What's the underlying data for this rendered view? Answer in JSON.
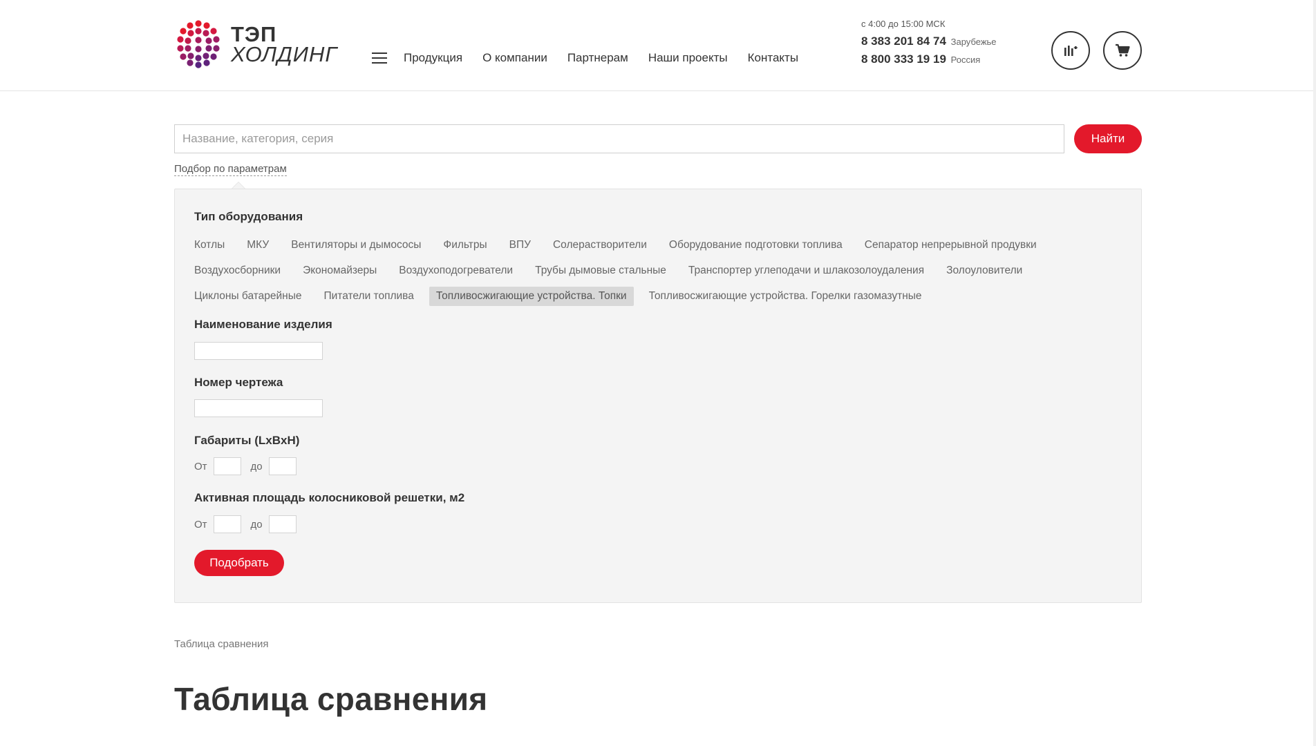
{
  "logo": {
    "line1": "ТЭП",
    "line2": "ХОЛДИНГ"
  },
  "nav": {
    "items": [
      "Продукция",
      "О компании",
      "Партнерам",
      "Наши проекты",
      "Контакты"
    ]
  },
  "contacts": {
    "hours": "с 4:00 до 15:00 МСК",
    "phone1": "8 383 201 84 74",
    "phone1_note": "Зарубежье",
    "phone2": "8 800 333 19 19",
    "phone2_note": "Россия"
  },
  "icons": {
    "menu": "hamburger-icon",
    "compare": "compare-icon",
    "cart": "cart-icon"
  },
  "search": {
    "placeholder": "Название, категория, серия",
    "value": "",
    "button": "Найти",
    "params_link": "Подбор по параметрам"
  },
  "filter": {
    "equipment_title": "Тип оборудования",
    "tag_rows": [
      [
        "Котлы",
        "МКУ",
        "Вентиляторы и дымососы",
        "Фильтры",
        "ВПУ",
        "Солерастворители",
        "Оборудование подготовки топлива",
        "Сепаратор непрерывной продувки"
      ],
      [
        "Воздухосборники",
        "Экономайзеры",
        "Воздухоподогреватели",
        "Трубы дымовые стальные",
        "Транспортер углеподачи и шлакозолоудаления",
        "Золоуловители"
      ],
      [
        "Циклоны батарейные",
        "Питатели топлива",
        "Топливосжигающие устройства. Топки",
        "Топливосжигающие устройства. Горелки газомазутные"
      ]
    ],
    "active_tag": "Топливосжигающие устройства. Топки",
    "name_title": "Наименование изделия",
    "drawing_title": "Номер чертежа",
    "size_title": "Габариты (LxBxH)",
    "area_title": "Активная площадь колосниковой решетки, м2",
    "from_label": "От",
    "to_label": "до",
    "apply_button": "Подобрать"
  },
  "breadcrumb": "Таблица сравнения",
  "page_title": "Таблица сравнения",
  "colors": {
    "accent": "#e3192b",
    "text": "#333333",
    "panel": "#f4f4f4"
  }
}
